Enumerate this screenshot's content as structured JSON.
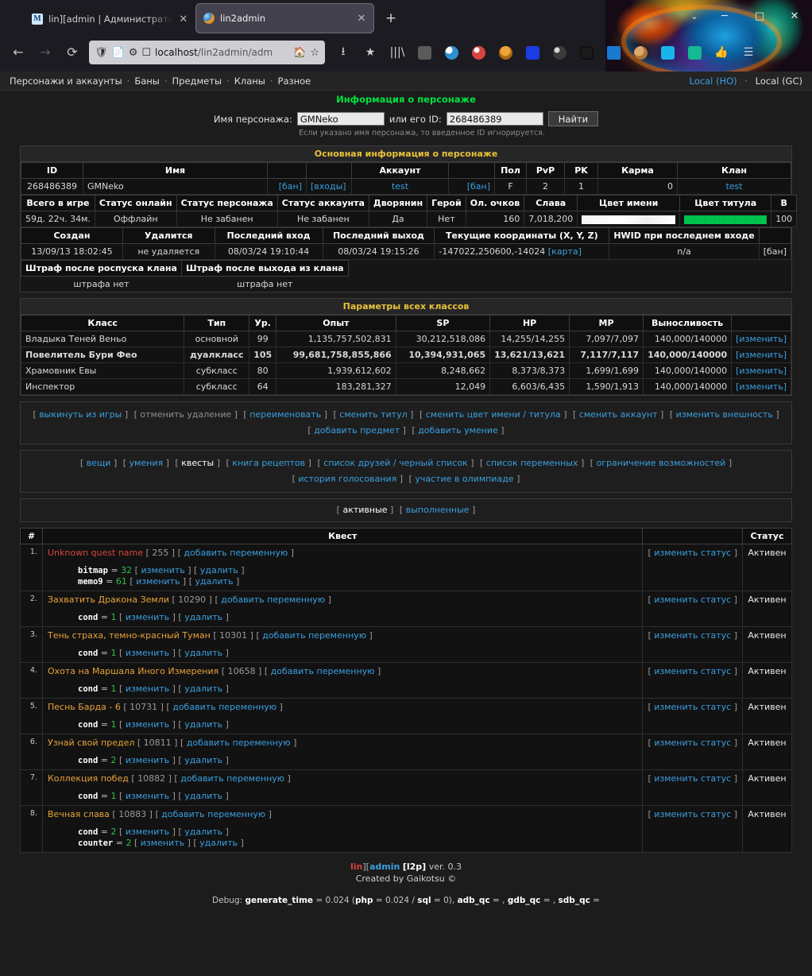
{
  "browser": {
    "tabs": [
      {
        "title": "lin][admin | Администраторы",
        "favicon": "m-letter-icon",
        "active": false
      },
      {
        "title": "lin2admin",
        "favicon": "lineage2-icon",
        "active": true
      }
    ],
    "new_tab_label": "+",
    "window_controls": {
      "chevron": "⌄",
      "minimize": "─",
      "maximize": "□",
      "close": "✕"
    },
    "nav": {
      "back": "←",
      "forward": "→",
      "reload": "⟳"
    },
    "url": {
      "host": "localhost",
      "path": "/lin2admin/adm",
      "full": "localhost/lin2admin/adm"
    },
    "url_icons": [
      "shield-off-icon",
      "page-icon",
      "settings-sliders-icon",
      "screenshot-off-icon"
    ],
    "url_right_icons": [
      "home-icon",
      "bookmark-star-icon"
    ],
    "toolbar_icons": [
      "downloads-icon",
      "save-to-pocket-icon",
      "library-icon",
      "ublock-origin-icon",
      "circle-blue-icon",
      "extension-red-icon",
      "monkey-icon",
      "download-manager-icon",
      "dark-reader-icon",
      "clipboard-icon",
      "s-blue-icon",
      "cookie-icon",
      "diamond-cyan-icon",
      "lamp-green-icon",
      "thumbs-up-icon",
      "hamburger-menu-icon"
    ]
  },
  "sitenav": {
    "items": [
      "Персонажи и аккаунты",
      "Баны",
      "Предметы",
      "Кланы",
      "Разное"
    ],
    "separator": "·",
    "right": {
      "ho": "Local (HO)",
      "sep": "·",
      "gc": "Local (GC)"
    }
  },
  "page_title": "Информация о персонаже",
  "search": {
    "name_label": "Имя персонажа:",
    "name_value": "GMNeko",
    "id_label": "или его ID:",
    "id_value": "268486389",
    "find_label": "Найти",
    "hint": "Если указано имя персонажа, то введенное ID игнорируется."
  },
  "main_info": {
    "title": "Основная информация о персонаже",
    "headers": [
      "ID",
      "Имя",
      "",
      "",
      "Аккаунт",
      "",
      "Пол",
      "PvP",
      "PK",
      "Карма",
      "Клан"
    ],
    "row": {
      "id": "268486389",
      "name": "GMNeko",
      "ban_link": "[бан]",
      "logins_link": "[входы]",
      "account": "test",
      "account_ban_link": "[бан]",
      "sex": "F",
      "pvp": "2",
      "pk": "1",
      "karma": "0",
      "clan": "test"
    },
    "headers2": [
      "Всего в игре",
      "Статус онлайн",
      "Статус персонажа",
      "Статус аккаунта",
      "Дворянин",
      "Герой",
      "Ол. очков",
      "Слава",
      "Цвет имени",
      "Цвет титула",
      "B"
    ],
    "row2": {
      "total_in_game": "59д. 22ч. 34м.",
      "online_status": "Оффлайн",
      "char_status": "Не забанен",
      "account_status": "Не забанен",
      "noble": "Да",
      "hero": "Нет",
      "olympiad_points": "160",
      "fame": "7,018,200",
      "name_color_hex": "#FFFFFF",
      "title_color_hex": "#00C24E",
      "b": "100"
    },
    "headers3": [
      "Создан",
      "Удалится",
      "Последний вход",
      "Последний выход",
      "Текущие координаты (X, Y, Z)",
      "HWID при последнем входе",
      ""
    ],
    "row3": {
      "created": "13/09/13 18:02:45",
      "delete_at": "не удаляется",
      "last_login": "08/03/24 19:10:44",
      "last_logout": "08/03/24 19:15:26",
      "coords": "-147022,250600,-14024",
      "map_link": "[карта]",
      "hwid": "n/a",
      "hwid_ban_link": "[бан]"
    },
    "headers4": [
      "Штраф после роспуска клана",
      "Штраф после выхода из клана"
    ],
    "row4": {
      "penalty_dissolve": "штрафа нет",
      "penalty_leave": "штрафа нет"
    }
  },
  "classes": {
    "title": "Параметры всех классов",
    "headers": [
      "Класс",
      "Тип",
      "Ур.",
      "Опыт",
      "SP",
      "HP",
      "MP",
      "Выносливость",
      ""
    ],
    "edit_label": "[изменить]",
    "rows": [
      {
        "name": "Владыка Теней Веньо",
        "type": "основной",
        "level": "99",
        "exp": "1,135,757,502,831",
        "sp": "30,212,518,086",
        "hp_cur": "14,255",
        "hp_max": "14,255",
        "mp_cur": "7,097",
        "mp_max": "7,097",
        "cp_cur": "140,000",
        "cp_max": "140000",
        "active": false
      },
      {
        "name": "Повелитель Бури Фео",
        "type": "дуалкласс",
        "level": "105",
        "exp": "99,681,758,855,866",
        "sp": "10,394,931,065",
        "hp_cur": "13,621",
        "hp_max": "13,621",
        "mp_cur": "7,117",
        "mp_max": "7,117",
        "cp_cur": "140,000",
        "cp_max": "140000",
        "active": true
      },
      {
        "name": "Храмовник Евы",
        "type": "субкласс",
        "level": "80",
        "exp": "1,939,612,602",
        "sp": "8,248,662",
        "hp_cur": "8,373",
        "hp_max": "8,373",
        "mp_cur": "1,699",
        "mp_max": "1,699",
        "cp_cur": "140,000",
        "cp_max": "140000",
        "active": false
      },
      {
        "name": "Инспектор",
        "type": "субкласс",
        "level": "64",
        "exp": "183,281,327",
        "sp": "12,049",
        "hp_cur": "6,603",
        "hp_max": "6,435",
        "mp_cur": "1,590",
        "mp_max": "1,913",
        "cp_cur": "140,000",
        "cp_max": "140000",
        "active": false
      }
    ]
  },
  "actions": {
    "row1": [
      "выкинуть из игры",
      "отменить удаление",
      "переименовать",
      "сменить титул",
      "сменить цвет имени / титула",
      "сменить аккаунт",
      "изменить внешность"
    ],
    "row1_disabled": [
      "отменить удаление"
    ],
    "row2": [
      "добавить предмет",
      "добавить умение"
    ]
  },
  "sections": {
    "row1": [
      "вещи",
      "умения",
      "квесты",
      "книга рецептов",
      "список друзей / черный список",
      "список переменных",
      "ограничение возможностей"
    ],
    "row2": [
      "история голосования",
      "участие в олимпиаде"
    ],
    "current": "квесты"
  },
  "quest_filter": {
    "items": [
      "активные",
      "выполненные"
    ],
    "current": "активные"
  },
  "quests": {
    "headers": {
      "num": "#",
      "quest": "Квест",
      "action": "",
      "status": "Статус"
    },
    "add_var_label": "[ добавить переменную ]",
    "change_status_label": "[ изменить статус ]",
    "edit_label": "[ изменить ]",
    "delete_label": "[ удалить ]",
    "rows": [
      {
        "n": "1.",
        "name": "Unknown quest name",
        "unknown": true,
        "id": "255",
        "status": "Активен",
        "vars": [
          {
            "k": "bitmap",
            "v": "32"
          },
          {
            "k": "memo9",
            "v": "61"
          }
        ]
      },
      {
        "n": "2.",
        "name": "Захватить Дракона Земли",
        "unknown": false,
        "id": "10290",
        "status": "Активен",
        "vars": [
          {
            "k": "cond",
            "v": "1"
          }
        ]
      },
      {
        "n": "3.",
        "name": "Тень страха, темно-красный Туман",
        "unknown": false,
        "id": "10301",
        "status": "Активен",
        "vars": [
          {
            "k": "cond",
            "v": "1"
          }
        ]
      },
      {
        "n": "4.",
        "name": "Охота на Маршала Иного Измерения",
        "unknown": false,
        "id": "10658",
        "status": "Активен",
        "vars": [
          {
            "k": "cond",
            "v": "1"
          }
        ]
      },
      {
        "n": "5.",
        "name": "Песнь Барда - 6",
        "unknown": false,
        "id": "10731",
        "status": "Активен",
        "vars": [
          {
            "k": "cond",
            "v": "1"
          }
        ]
      },
      {
        "n": "6.",
        "name": "Узнай свой предел",
        "unknown": false,
        "id": "10811",
        "status": "Активен",
        "vars": [
          {
            "k": "cond",
            "v": "2"
          }
        ]
      },
      {
        "n": "7.",
        "name": "Коллекция побед",
        "unknown": false,
        "id": "10882",
        "status": "Активен",
        "vars": [
          {
            "k": "cond",
            "v": "1"
          }
        ]
      },
      {
        "n": "8.",
        "name": "Вечная слава",
        "unknown": false,
        "id": "10883",
        "status": "Активен",
        "vars": [
          {
            "k": "cond",
            "v": "2"
          },
          {
            "k": "counter",
            "v": "2"
          }
        ]
      }
    ]
  },
  "footer": {
    "lin": "lin",
    "br1": "][",
    "admin": "admin",
    "l2p": "[l2p]",
    "ver": "ver. 0.3",
    "created_by": "Created by Gaikotsu ©",
    "debug": "Debug: generate_time = 0.024 (php = 0.024 / sql = 0), adb_qc = , gdb_qc = , sdb_qc ="
  }
}
